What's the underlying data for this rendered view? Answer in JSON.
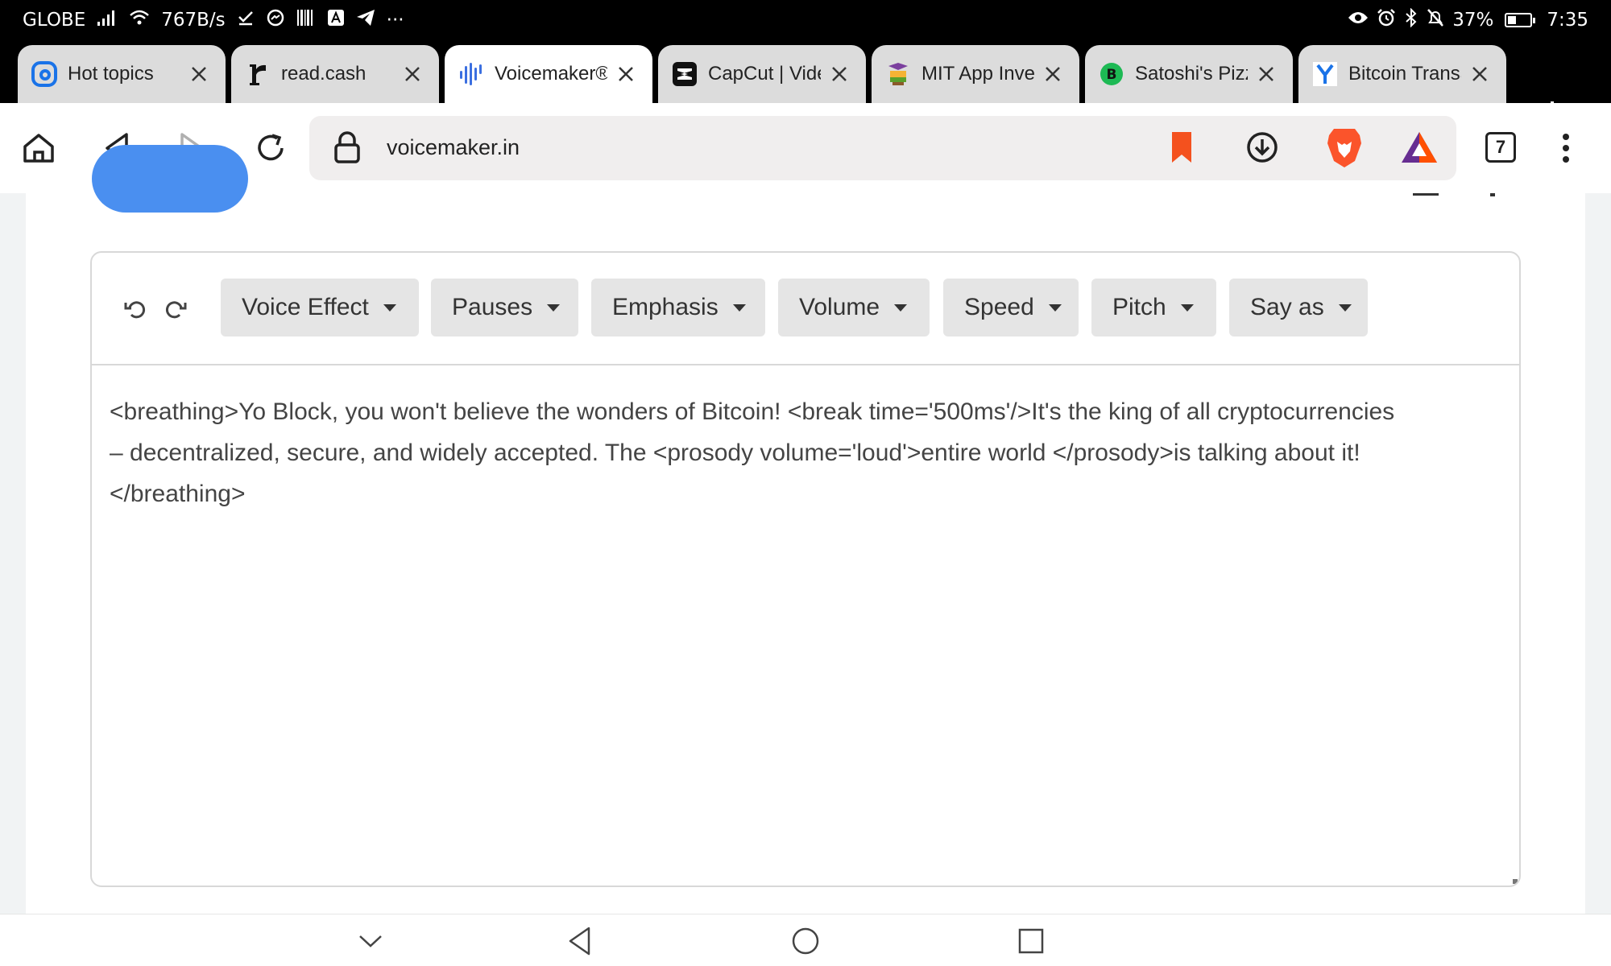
{
  "status_bar": {
    "carrier": "GLOBE",
    "net_speed": "767B/s",
    "battery": "37%",
    "battery_level": 0.37,
    "time": "7:35",
    "more": "···"
  },
  "tabs": [
    {
      "title": "Hot topics",
      "icon": "brand-b-icon",
      "active": false
    },
    {
      "title": "read.cash",
      "icon": "read-cash-r-icon",
      "active": false
    },
    {
      "title": "Voicemaker®",
      "icon": "waveform-icon",
      "active": true
    },
    {
      "title": "CapCut | Vide",
      "icon": "capcut-icon",
      "active": false
    },
    {
      "title": "MIT App Inve",
      "icon": "mit-app-inventor-icon",
      "active": false
    },
    {
      "title": "Satoshi's Pizz",
      "icon": "bitcoin-icon",
      "active": false
    },
    {
      "title": "Bitcoin Transa",
      "icon": "y-combinator-icon",
      "active": false
    }
  ],
  "toolbar": {
    "url": "voicemaker.in",
    "tab_count": "7"
  },
  "editor": {
    "toolbar_items": [
      "Voice Effect",
      "Pauses",
      "Emphasis",
      "Volume",
      "Speed",
      "Pitch",
      "Say as"
    ],
    "text_lines": [
      "<breathing>Yo Block, you won't believe the wonders of Bitcoin! <break time='500ms'/>It's the king of all cryptocurrencies",
      "– decentralized, secure, and widely accepted. The <prosody volume='loud'>entire world </prosody>is talking about it!",
      "</breathing>"
    ]
  },
  "colors": {
    "accent_blue": "#4a8ff0",
    "bookmark_orange": "#f4511e",
    "brave_orange": "#fb542b",
    "bat_purple": "#662d91"
  }
}
